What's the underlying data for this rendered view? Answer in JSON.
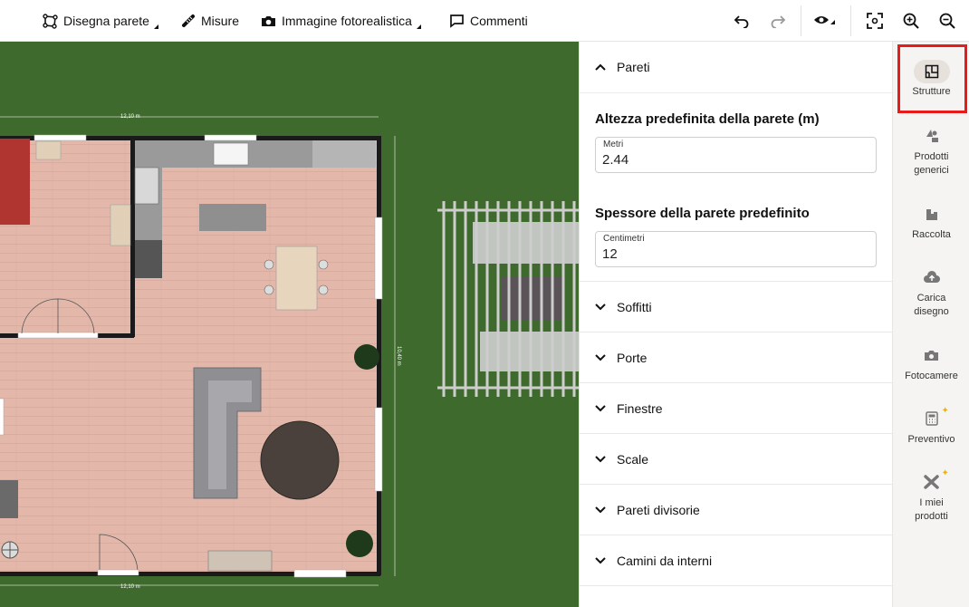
{
  "toolbar": {
    "draw_wall": "Disegna parete",
    "measures": "Misure",
    "photorealistic": "Immagine fotorealistica",
    "comments": "Commenti"
  },
  "canvas": {
    "dim_top": "12,10 m",
    "dim_bottom": "12,10 m",
    "dim_right": "10,40 m"
  },
  "panel": {
    "walls_header": "Pareti",
    "height_title": "Altezza predefinita della parete (m)",
    "height_unit": "Metri",
    "height_value": "2.44",
    "thickness_title": "Spessore della parete predefinito",
    "thickness_unit": "Centimetri",
    "thickness_value": "12",
    "sections": [
      "Soffitti",
      "Porte",
      "Finestre",
      "Scale",
      "Pareti divisorie",
      "Camini da interni"
    ]
  },
  "rail": {
    "items": [
      {
        "label": "Strutture",
        "icon": "structure-icon"
      },
      {
        "label": "Prodotti generici",
        "icon": "generic-products-icon"
      },
      {
        "label": "Raccolta",
        "icon": "collection-icon"
      },
      {
        "label": "Carica disegno",
        "icon": "upload-drawing-icon"
      },
      {
        "label": "Fotocamere",
        "icon": "camera-icon"
      },
      {
        "label": "Preventivo",
        "icon": "calculator-icon"
      },
      {
        "label": "I miei prodotti",
        "icon": "my-products-icon"
      }
    ]
  },
  "colors": {
    "grass": "#3f6a2d",
    "floor": "#e3b8aa",
    "wall": "#1a1a1a",
    "highlight": "#e81b1b"
  }
}
